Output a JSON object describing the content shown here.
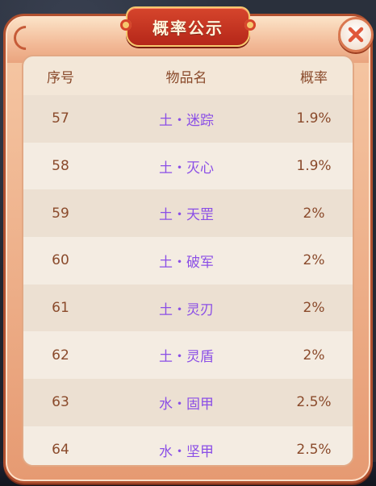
{
  "dialog": {
    "title": "概率公示",
    "close_label": "×"
  },
  "table": {
    "headers": {
      "index": "序号",
      "item": "物品名",
      "rate": "概率"
    },
    "rows": [
      {
        "index": "57",
        "item": "土・迷踪",
        "rate": "1.9%"
      },
      {
        "index": "58",
        "item": "土・灭心",
        "rate": "1.9%"
      },
      {
        "index": "59",
        "item": "土・天罡",
        "rate": "2%"
      },
      {
        "index": "60",
        "item": "土・破军",
        "rate": "2%"
      },
      {
        "index": "61",
        "item": "土・灵刃",
        "rate": "2%"
      },
      {
        "index": "62",
        "item": "土・灵盾",
        "rate": "2%"
      },
      {
        "index": "63",
        "item": "水・固甲",
        "rate": "2.5%"
      },
      {
        "index": "64",
        "item": "水・坚甲",
        "rate": "2.5%"
      }
    ]
  },
  "colors": {
    "item_text": "#8b4fe6",
    "plain_text": "#8a4a2b",
    "title_plaque": "#c93421",
    "panel_border": "#b0502f"
  }
}
